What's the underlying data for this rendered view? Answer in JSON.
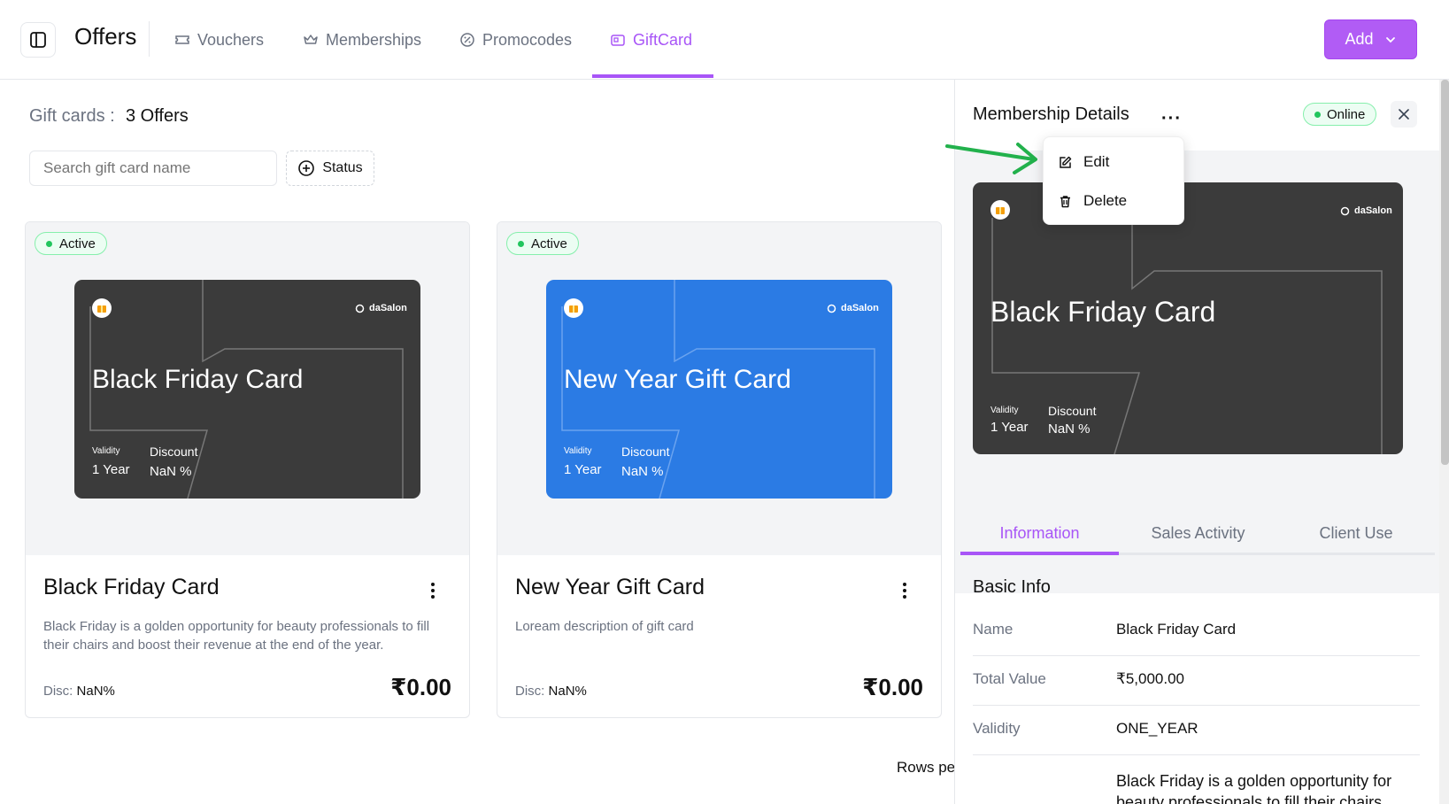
{
  "header": {
    "title": "Offers",
    "tabs": [
      {
        "label": "Vouchers",
        "icon": "ticket-icon"
      },
      {
        "label": "Memberships",
        "icon": "crown-icon"
      },
      {
        "label": "Promocodes",
        "icon": "badge-percent-icon"
      },
      {
        "label": "GiftCard",
        "icon": "gift-card-icon",
        "active": true
      }
    ],
    "add_label": "Add",
    "accent": "#a855f7"
  },
  "list": {
    "count_label": "Gift cards :",
    "count_value": "3 Offers",
    "search_placeholder": "Search gift card name",
    "status_label": "Status",
    "rows_per_page": "Rows pe"
  },
  "cards": [
    {
      "status": "Active",
      "name": "Black Friday Card",
      "brand": "daSalon",
      "validity_label": "Validity",
      "validity": "1 Year",
      "discount_label": "Discount",
      "discount": "NaN %",
      "description": "Black Friday is a golden opportunity for beauty professionals to fill their chairs and boost their revenue at the end of the year.",
      "disc_label": "Disc:",
      "disc_value": "NaN%",
      "price": "₹0.00",
      "color": "#3b3b3b"
    },
    {
      "status": "Active",
      "name": "New Year Gift Card",
      "brand": "daSalon",
      "validity_label": "Validity",
      "validity": "1 Year",
      "discount_label": "Discount",
      "discount": "NaN %",
      "description": "Loream description of gift card",
      "disc_label": "Disc:",
      "disc_value": "NaN%",
      "price": "₹0.00",
      "color": "#2b7be4"
    }
  ],
  "panel": {
    "title": "Membership Details",
    "status": "Online",
    "menu": [
      {
        "label": "Edit",
        "icon": "edit-icon"
      },
      {
        "label": "Delete",
        "icon": "trash-icon"
      }
    ],
    "card": {
      "name": "Black Friday Card",
      "brand": "daSalon",
      "validity_label": "Validity",
      "validity": "1 Year",
      "discount_label": "Discount",
      "discount": "NaN %"
    },
    "tabs": [
      "Information",
      "Sales Activity",
      "Client Use"
    ],
    "section_title": "Basic Info",
    "info": [
      {
        "label": "Name",
        "value": "Black Friday Card"
      },
      {
        "label": "Total Value",
        "value": "₹5,000.00"
      },
      {
        "label": "Validity",
        "value": "ONE_YEAR"
      }
    ],
    "description": "Black Friday is a golden opportunity for beauty professionals to fill their chairs"
  }
}
